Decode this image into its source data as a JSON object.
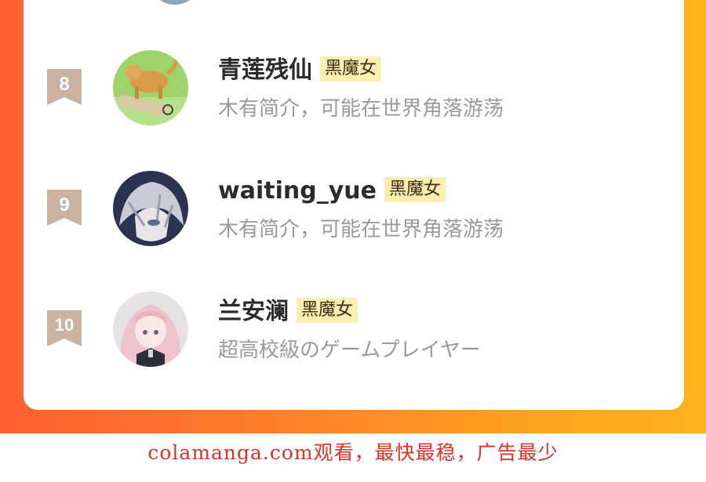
{
  "ranking": [
    {
      "rank": "8",
      "name": "青莲残仙",
      "badge": "黑魔女",
      "description": "木有简介，可能在世界角落游荡",
      "avatar_icon": "dog-figurine-avatar"
    },
    {
      "rank": "9",
      "name": "waiting_yue",
      "badge": "黑魔女",
      "description": "木有简介，可能在世界角落游荡",
      "avatar_icon": "anime-boy-avatar"
    },
    {
      "rank": "10",
      "name": "兰安澜",
      "badge": "黑魔女",
      "description": "超高校級のゲームプレイヤー",
      "avatar_icon": "anime-girl-avatar"
    }
  ],
  "watermark": "colamanga.com观看，最快最稳，广告最少",
  "colors": {
    "rank_badge": "#c9b29f",
    "title_badge_bg": "#fbeeb0",
    "watermark": "#e0302a"
  }
}
